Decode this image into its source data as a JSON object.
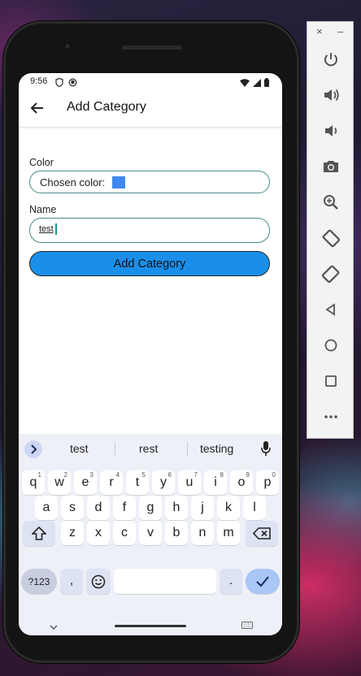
{
  "status_bar": {
    "time": "9:56",
    "icons": [
      "shield-icon",
      "privacy-icon",
      "wifi-icon",
      "signal-icon",
      "battery-icon"
    ]
  },
  "app_bar": {
    "back_icon": "arrow-left-icon",
    "title": "Add Category"
  },
  "form": {
    "color_label": "Color",
    "color_field_text": "Chosen color:",
    "chosen_color": "#3f87f0",
    "name_label": "Name",
    "name_value": "test",
    "submit_label": "Add Category",
    "submit_color": "#1a8fea"
  },
  "keyboard": {
    "suggestions": [
      "test",
      "rest",
      "testing"
    ],
    "row1": [
      {
        "key": "q",
        "sup": "1"
      },
      {
        "key": "w",
        "sup": "2"
      },
      {
        "key": "e",
        "sup": "3"
      },
      {
        "key": "r",
        "sup": "4"
      },
      {
        "key": "t",
        "sup": "5"
      },
      {
        "key": "y",
        "sup": "6"
      },
      {
        "key": "u",
        "sup": "7"
      },
      {
        "key": "i",
        "sup": "8"
      },
      {
        "key": "o",
        "sup": "9"
      },
      {
        "key": "p",
        "sup": "0"
      }
    ],
    "row2": [
      "a",
      "s",
      "d",
      "f",
      "g",
      "h",
      "j",
      "k",
      "l"
    ],
    "row3": [
      "z",
      "x",
      "c",
      "v",
      "b",
      "n",
      "m"
    ],
    "symbols_label": "?123",
    "comma": ",",
    "period": "."
  },
  "emulator_panel": {
    "window_controls": [
      "×",
      "–"
    ],
    "tools": [
      "power-icon",
      "volume-up-icon",
      "volume-down-icon",
      "camera-icon",
      "zoom-icon",
      "rotate-left-icon",
      "rotate-right-icon",
      "back-icon",
      "home-icon",
      "overview-icon",
      "more-icon"
    ]
  }
}
